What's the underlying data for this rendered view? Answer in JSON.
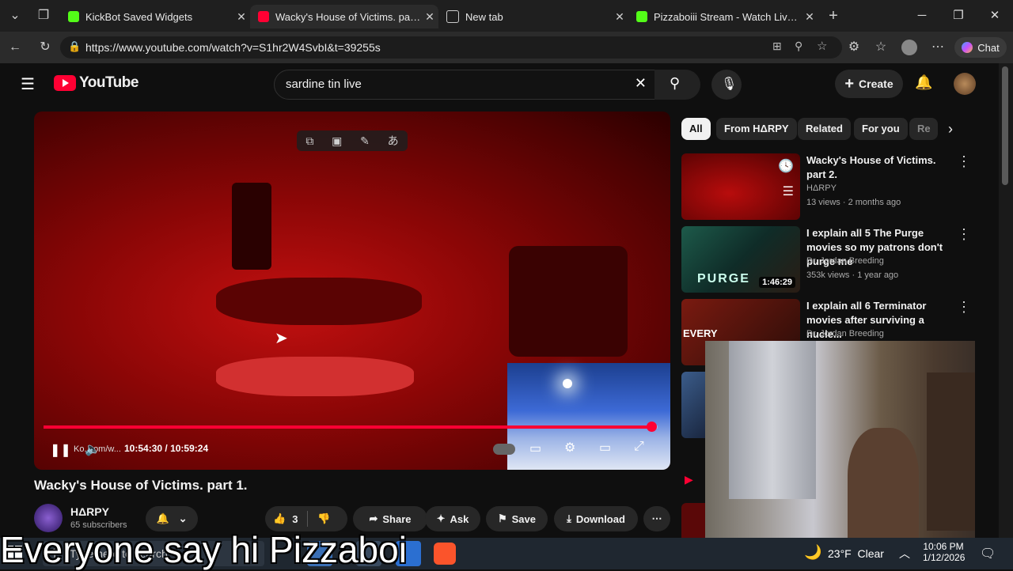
{
  "browser": {
    "tabs": [
      {
        "label": "KickBot Saved Widgets",
        "icon": "kickbot-icon",
        "color": "#53fc18"
      },
      {
        "label": "Wacky's House of Victims. part 1.",
        "icon": "youtube-icon",
        "color": "#ff0033"
      },
      {
        "label": "New tab",
        "icon": "newtab-icon",
        "color": "#cccccc"
      },
      {
        "label": "Pizzaboiii Stream - Watch Live on K",
        "icon": "kick-icon",
        "color": "#53fc18"
      }
    ],
    "url": "https://www.youtube.com/watch?v=S1hr2W4SvbI&t=39255s",
    "chat_label": "Chat"
  },
  "youtube": {
    "logo_text": "YouTube",
    "search_query": "sardine tin live",
    "create_label": "Create",
    "video": {
      "time_current": "10:54:30",
      "time_total": "10:59:24",
      "time_separator": "/",
      "overlay_url_text": "Ko..com/w...",
      "progress": 0.99,
      "title": "Wacky's House of Victims. part 1."
    },
    "channel": {
      "name": "HΔRPY",
      "subscribers": "65 subscribers"
    },
    "actions": {
      "like_count": "3",
      "share": "Share",
      "ask": "Ask",
      "save": "Save",
      "download": "Download"
    },
    "chips": [
      "All",
      "From HΔRPY",
      "Related",
      "For you",
      "Re"
    ],
    "recommendations": [
      {
        "title": "Wacky's House of Victims. part 2.",
        "channel": "HΔRPY",
        "meta": "13 views · 2 months ago",
        "duration": ""
      },
      {
        "title": "I explain all 5 The Purge movies so my patrons don't purge me",
        "channel": "Dr. Jordan Breeding",
        "meta": "353k views · 1 year ago",
        "duration": "1:46:29"
      },
      {
        "title": "I explain all 6 Terminator movies after surviving a nucle...",
        "channel": "Dr. Jordan Breeding",
        "meta": "",
        "duration": ""
      }
    ]
  },
  "overlay_text": "Everyone say hi Pizzaboi",
  "taskbar": {
    "search_placeholder": "Type here to search",
    "weather": "23°F  Clear",
    "time": "10:06 PM",
    "date": "1/12/2026"
  }
}
